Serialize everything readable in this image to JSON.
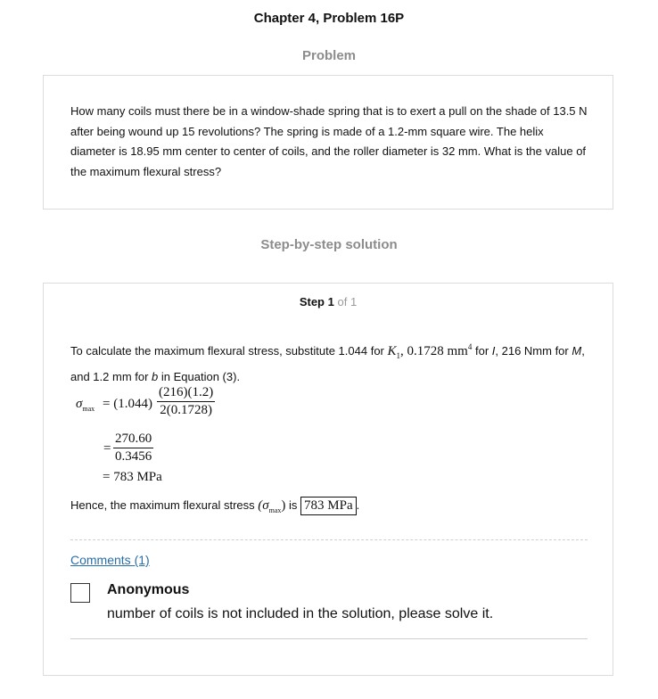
{
  "chapter_title": "Chapter 4, Problem 16P",
  "problem_heading": "Problem",
  "problem_text": "How many coils must there be in a window-shade spring that is to exert a pull on the shade of 13.5 N after being wound up 15 revolutions? The spring is made of a 1.2-mm square wire. The helix diameter is 18.95 mm center to center of coils, and the roller diameter is 32 mm. What is the value of the maximum flexural stress?",
  "solution_heading": "Step-by-step solution",
  "step": {
    "label": "Step",
    "number": "1",
    "of_text": "of 1"
  },
  "intro": {
    "part1": "To calculate the maximum flexural stress, substitute 1.044 for ",
    "k_symbol": "K",
    "k_sub": "1",
    "comma": ", ",
    "i_value": "0.1728 mm",
    "i_sup": "4",
    "part2": " for ",
    "i_symbol": "I",
    "part3": ", 216 Nmm for ",
    "m_symbol": "M",
    "part4": ", and 1.2 mm for ",
    "b_symbol": "b",
    "part5": " in Equation (3)."
  },
  "equation": {
    "sigma": "σ",
    "sigma_sub": "max",
    "eq1_lhs": "= (1.044)",
    "eq1_num": "(216)(1.2)",
    "eq1_den": "2(0.1728)",
    "eq2_eq": "=",
    "eq2_num": "270.60",
    "eq2_den": "0.3456",
    "eq3": "= 783 MPa"
  },
  "conclusion": {
    "text1": "Hence, the maximum flexural stress ",
    "sym": "(σ",
    "sym_sub": "max",
    "sym_close": ")",
    "text2": " is ",
    "answer": "783 MPa",
    "text3": "."
  },
  "comments_link": "Comments (1)",
  "comment": {
    "author": "Anonymous",
    "text": "number of coils is not included in the solution, please solve it."
  }
}
